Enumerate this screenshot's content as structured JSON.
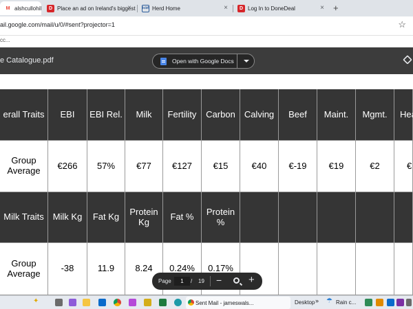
{
  "browser": {
    "tabs": [
      {
        "label": "alshcullohill",
        "icon": "gmail-icon",
        "active": true
      },
      {
        "label": "Place an ad on Ireland's biggest",
        "icon": "donedeal-icon"
      },
      {
        "label": "Herd Home",
        "icon": "icbf-icon"
      },
      {
        "label": "Log In to DoneDeal",
        "icon": "donedeal-icon"
      }
    ],
    "url": "ail.google.com/mail/u/0/#sent?projector=1",
    "bookmarks_text": "cc..."
  },
  "pdf": {
    "title": "e Catalogue.pdf",
    "open_with_label": "Open with Google Docs"
  },
  "table": {
    "row1": [
      "erall Traits",
      "EBI",
      "EBI Rel.",
      "Milk",
      "Fertility",
      "Carbon",
      "Calving",
      "Beef",
      "Maint.",
      "Mgmt.",
      "Hea"
    ],
    "row2": [
      "Group Average",
      "€266",
      "57%",
      "€77",
      "€127",
      "€15",
      "€40",
      "€-19",
      "€19",
      "€2",
      "€"
    ],
    "row3": [
      "Milk Traits",
      "Milk Kg",
      "Fat Kg",
      "Protein Kg",
      "Fat %",
      "Protein %",
      "",
      "",
      "",
      "",
      ""
    ],
    "row4": [
      "Group Average",
      "-38",
      "11.9",
      "8.24",
      "0.24%",
      "0.17%",
      "",
      "",
      "",
      "",
      ""
    ]
  },
  "pager": {
    "label": "Page",
    "current": "1",
    "separator": "/",
    "total": "19",
    "minus": "−",
    "plus": "+"
  },
  "taskbar": {
    "active_app_label": "Sent Mail - jameswals...",
    "desktop_label": "Desktop",
    "chevron": "»",
    "weather_label": "Rain c..."
  }
}
